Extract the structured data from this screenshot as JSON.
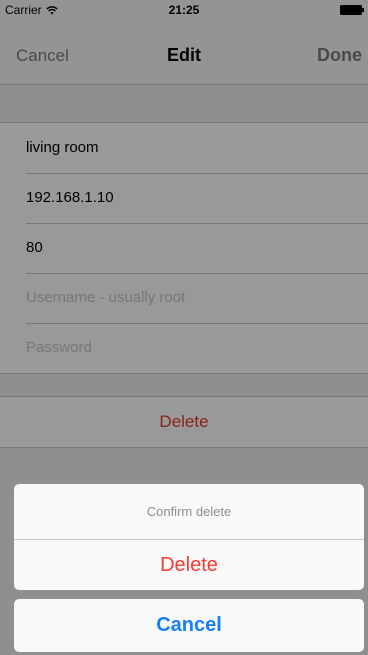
{
  "status_bar": {
    "carrier": "Carrier",
    "time": "21:25"
  },
  "nav": {
    "cancel_label": "Cancel",
    "title": "Edit",
    "done_label": "Done"
  },
  "form": {
    "name_value": "living room",
    "host_value": "192.168.1.10",
    "port_value": "80",
    "username_placeholder": "Username - usually root",
    "password_placeholder": "Password"
  },
  "delete_label": "Delete",
  "action_sheet": {
    "title": "Confirm delete",
    "delete_label": "Delete",
    "cancel_label": "Cancel"
  },
  "colors": {
    "destructive": "#e03c2f",
    "action_blue": "#157efb",
    "sheet_background": "#f9f9f9"
  }
}
